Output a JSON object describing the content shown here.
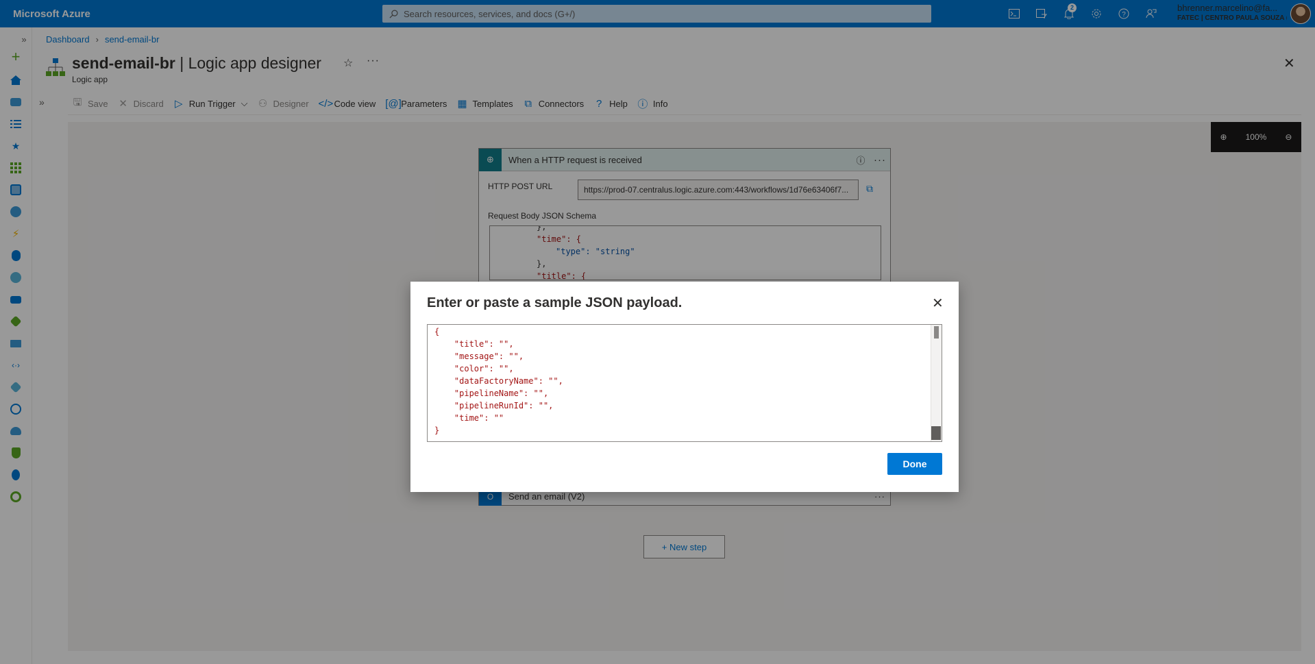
{
  "topbar": {
    "brand": "Microsoft Azure",
    "search_placeholder": "Search resources, services, and docs (G+/)",
    "notifications_count": "2",
    "account_name": "bhrenner.marcelino@fa...",
    "account_org": "FATEC | CENTRO PAULA SOUZA (...",
    "icons": [
      "cloud-shell-icon",
      "directory-filter-icon",
      "notifications-icon",
      "settings-icon",
      "help-icon",
      "feedback-icon"
    ]
  },
  "breadcrumb": {
    "root": "Dashboard",
    "current": "send-email-br"
  },
  "header": {
    "resource_name": "send-email-br",
    "page_name": "| Logic app designer",
    "subtitle": "Logic app"
  },
  "toolbar": {
    "save": "Save",
    "discard": "Discard",
    "run_trigger": "Run Trigger",
    "designer": "Designer",
    "code_view": "Code view",
    "parameters": "Parameters",
    "templates": "Templates",
    "connectors": "Connectors",
    "help": "Help",
    "info": "Info"
  },
  "canvas": {
    "zoom_level": "100%",
    "trigger": {
      "title": "When a HTTP request is received",
      "url_label": "HTTP POST URL",
      "url_value": "https://prod-07.centralus.logic.azure.com:443/workflows/1d76e63406f7...",
      "schema_label": "Request Body JSON Schema",
      "schema_lines": [
        "},",
        "\"time\": {",
        "\"type\": \"string\"",
        "},",
        "\"title\": {"
      ]
    },
    "action": {
      "title": "Send an email (V2)"
    },
    "new_step": "+ New step"
  },
  "modal": {
    "title": "Enter or paste a sample JSON payload.",
    "payload": "{\n    \"title\": \"\",\n    \"message\": \"\",\n    \"color\": \"\",\n    \"dataFactoryName\": \"\",\n    \"pipelineName\": \"\",\n    \"pipelineRunId\": \"\",\n    \"time\": \"\"\n}",
    "done_label": "Done"
  },
  "colors": {
    "accent": "#0078d4",
    "topbar": "#0078d4",
    "trigger_header": "#127d8a"
  }
}
